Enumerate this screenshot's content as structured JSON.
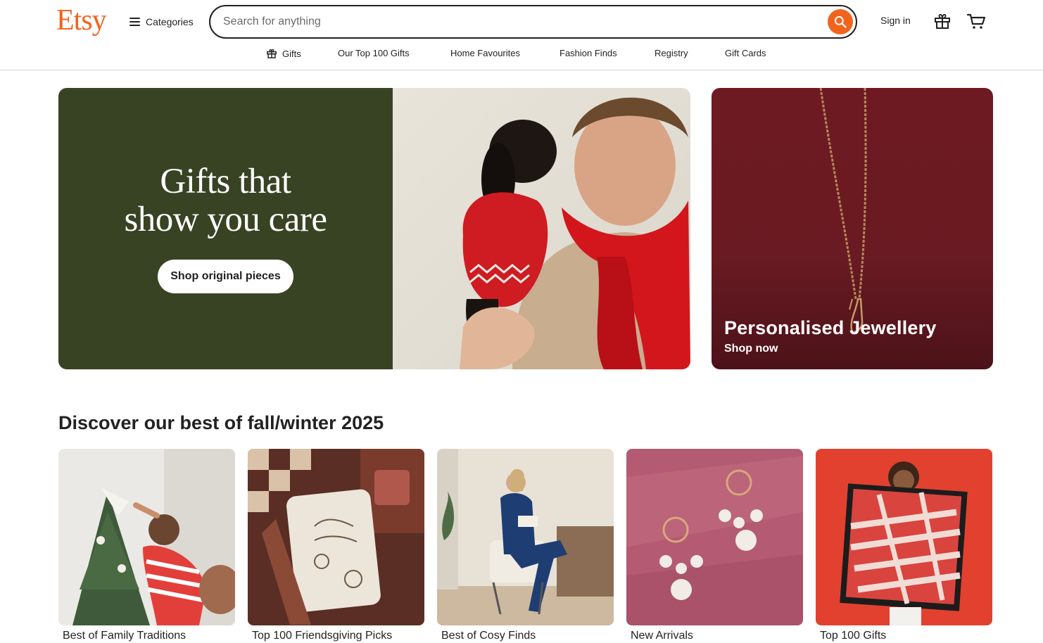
{
  "header": {
    "logo": "Etsy",
    "categories_label": "Categories",
    "search_placeholder": "Search for anything",
    "signin_label": "Sign in"
  },
  "subnav": [
    {
      "label": "Gifts",
      "icon": "gift-icon"
    },
    {
      "label": "Our Top 100 Gifts"
    },
    {
      "label": "Home Favourites"
    },
    {
      "label": "Fashion Finds"
    },
    {
      "label": "Registry"
    },
    {
      "label": "Gift Cards"
    }
  ],
  "hero": {
    "title_line1": "Gifts that",
    "title_line2": "show you care",
    "button_label": "Shop original pieces"
  },
  "promo": {
    "title": "Personalised Jewellery",
    "subtitle": "Shop now"
  },
  "discover": {
    "title": "Discover our best of fall/winter 2025",
    "cards": [
      {
        "label": "Best of Family Traditions"
      },
      {
        "label": "Top 100 Friendsgiving Picks"
      },
      {
        "label": "Best of Cosy Finds"
      },
      {
        "label": "New Arrivals"
      },
      {
        "label": "Top 100 Gifts"
      }
    ]
  },
  "colors": {
    "brand": "#F1641E",
    "hero_green": "#384323",
    "promo_burgundy": "#6a1a22"
  }
}
